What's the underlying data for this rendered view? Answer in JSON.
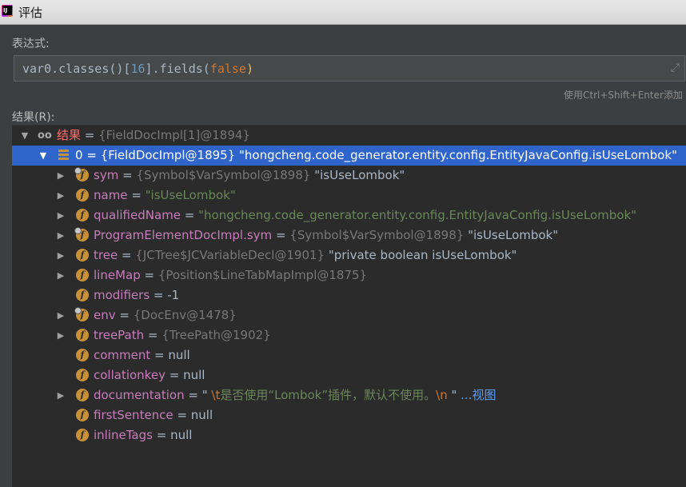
{
  "window": {
    "title": "评估"
  },
  "expression": {
    "label": "表达式:",
    "code": {
      "part1": "var0.classes()[",
      "index": "16",
      "part2": "].fields(",
      "arg": "false",
      "part3": ")"
    },
    "hint": "使用Ctrl+Shift+Enter添加"
  },
  "result": {
    "label": "结果(R):",
    "root": {
      "name": "结果",
      "eq": " = ",
      "type": "{FieldDocImpl[1]@1894}"
    },
    "item0": {
      "name": "0",
      "eq": " = ",
      "type": "{FieldDocImpl@1895}",
      "value": " \"hongcheng.code_generator.entity.config.EntityJavaConfig.isUseLombok\""
    },
    "fields": [
      {
        "name": "sym",
        "eq": " = ",
        "type": "{Symbol$VarSymbol@1898}",
        "value": " \"isUseLombok\""
      },
      {
        "name": "name",
        "eq": " = ",
        "type": "",
        "value": "\"isUseLombok\""
      },
      {
        "name": "qualifiedName",
        "eq": " = ",
        "type": "",
        "value": "\"hongcheng.code_generator.entity.config.EntityJavaConfig.isUseLombok\""
      },
      {
        "name": "ProgramElementDocImpl.sym",
        "eq": " = ",
        "type": "{Symbol$VarSymbol@1898}",
        "value": " \"isUseLombok\""
      },
      {
        "name": "tree",
        "eq": " = ",
        "type": "{JCTree$JCVariableDecl@1901}",
        "value": " \"private boolean isUseLombok\""
      },
      {
        "name": "lineMap",
        "eq": " = ",
        "type": "{Position$LineTabMapImpl@1875}",
        "value": ""
      },
      {
        "name": "modifiers",
        "eq": " = ",
        "type": "",
        "value": "-1"
      },
      {
        "name": "env",
        "eq": " = ",
        "type": "{DocEnv@1478}",
        "value": ""
      },
      {
        "name": "treePath",
        "eq": " = ",
        "type": "{TreePath@1902}",
        "value": ""
      },
      {
        "name": "comment",
        "eq": " = ",
        "type": "",
        "value": "null"
      },
      {
        "name": "collationkey",
        "eq": " = ",
        "type": "",
        "value": "null"
      },
      {
        "name": "documentation",
        "eq": " = ",
        "type": "",
        "value": ""
      },
      {
        "name": "firstSentence",
        "eq": " = ",
        "type": "",
        "value": "null"
      },
      {
        "name": "inlineTags",
        "eq": " = ",
        "type": "",
        "value": "null"
      }
    ],
    "documentation": {
      "open": "\" ",
      "escape_t": "\\t",
      "text": "是否使用“Lombok”插件，默认不使用。",
      "escape_n": "\\n",
      "close": " \" ",
      "view_link": "...视图"
    }
  }
}
